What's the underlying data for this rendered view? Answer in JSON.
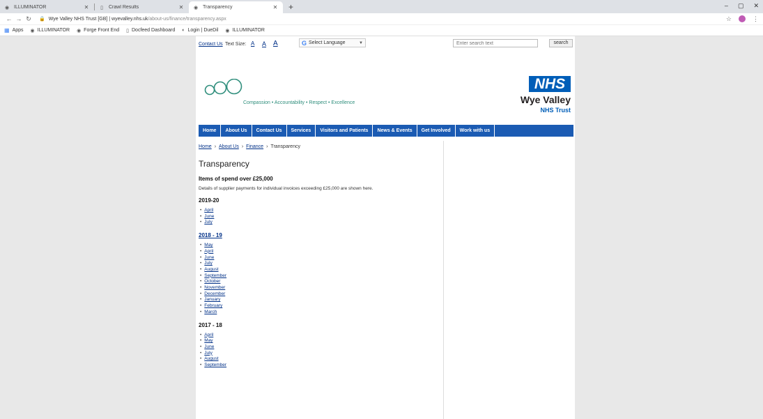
{
  "browser": {
    "tabs": [
      {
        "label": "ILLUMINATOR",
        "active": false
      },
      {
        "label": "Crawl Results",
        "active": false
      },
      {
        "label": "Transparency",
        "active": true
      }
    ],
    "url_host": "Wye Valley NHS Trust [GB]  |  wyevalley.nhs.uk",
    "url_path": "/about-us/finance/transparency.aspx",
    "bookmarks": [
      "Apps",
      "ILLUMINATOR",
      "Forge Front End",
      "Docfeed Dashboard",
      "Login | DueDil",
      "ILLUMINATOR"
    ]
  },
  "util": {
    "contact": "Contact Us",
    "text_size": "Text Size:",
    "size_a": [
      "A",
      "A",
      "A"
    ],
    "language": "Select Language",
    "search_placeholder": "Enter search text",
    "search_button": "search"
  },
  "brand": {
    "tagline": "Compassion • Accountability • Respect • Excellence",
    "nhs": "NHS",
    "name": "Wye Valley",
    "trust": "NHS Trust",
    "colors": {
      "nhs_blue": "#005eb8",
      "nav_blue": "#1b5bb3",
      "tagline_green": "#2f8e7c"
    }
  },
  "nav": [
    "Home",
    "About Us",
    "Contact Us",
    "Services",
    "Visitors and Patients",
    "News & Events",
    "Get Involved",
    "Work with us"
  ],
  "breadcrumb": [
    "Home",
    "About Us",
    "Finance",
    "Transparency"
  ],
  "main": {
    "title": "Transparency",
    "subtitle": "Items of spend over £25,000",
    "description": "Details of supplier payments for individual invoices exceeding £25,000 are shown here.",
    "years": [
      {
        "label": "2019-20",
        "link": false,
        "months": [
          "April",
          "June",
          "July"
        ]
      },
      {
        "label": "2018 - 19",
        "link": true,
        "months": [
          "May",
          "April",
          "June",
          "July",
          "August",
          "September",
          "October",
          "November",
          "December",
          "January",
          "February",
          "March"
        ]
      },
      {
        "label": "2017 - 18",
        "link": false,
        "months": [
          "April",
          "May",
          "June",
          "July",
          "August",
          "September"
        ]
      }
    ]
  }
}
